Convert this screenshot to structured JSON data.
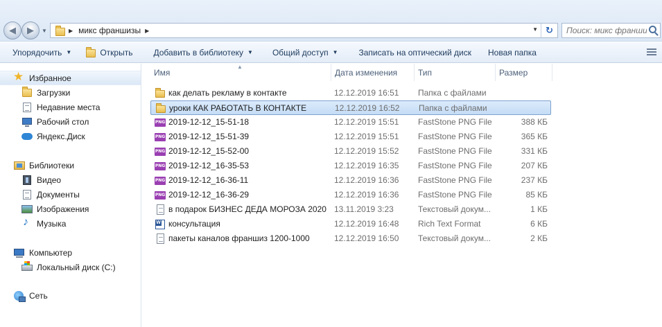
{
  "address": {
    "breadcrumb": "микс франшизы",
    "search_placeholder": "Поиск: микс франшизы"
  },
  "toolbar": {
    "organize": "Упорядочить",
    "open": "Открыть",
    "add_library": "Добавить в библиотеку",
    "share": "Общий доступ",
    "burn": "Записать на оптический диск",
    "new_folder": "Новая папка"
  },
  "nav": {
    "favorites": "Избранное",
    "downloads": "Загрузки",
    "recent": "Недавние места",
    "desktop": "Рабочий стол",
    "yadisk": "Яндекс.Диск",
    "libraries": "Библиотеки",
    "video": "Видео",
    "documents": "Документы",
    "images": "Изображения",
    "music": "Музыка",
    "computer": "Компьютер",
    "local_disk": "Локальный диск (C:)",
    "network": "Сеть"
  },
  "columns": {
    "name": "Имя",
    "date": "Дата изменения",
    "type": "Тип",
    "size": "Размер"
  },
  "files": [
    {
      "name": "как делать рекламу в контакте",
      "date": "12.12.2019 16:51",
      "type": "Папка с файлами",
      "size": "",
      "icon": "folder-icon"
    },
    {
      "name": "уроки КАК РАБОТАТЬ В КОНТАКТЕ",
      "date": "12.12.2019 16:52",
      "type": "Папка с файлами",
      "size": "",
      "icon": "folder-icon"
    },
    {
      "name": "2019-12-12_15-51-18",
      "date": "12.12.2019 15:51",
      "type": "FastStone PNG File",
      "size": "388 КБ",
      "icon": "png-file-icon"
    },
    {
      "name": "2019-12-12_15-51-39",
      "date": "12.12.2019 15:51",
      "type": "FastStone PNG File",
      "size": "365 КБ",
      "icon": "png-file-icon"
    },
    {
      "name": "2019-12-12_15-52-00",
      "date": "12.12.2019 15:52",
      "type": "FastStone PNG File",
      "size": "331 КБ",
      "icon": "png-file-icon"
    },
    {
      "name": "2019-12-12_16-35-53",
      "date": "12.12.2019 16:35",
      "type": "FastStone PNG File",
      "size": "207 КБ",
      "icon": "png-file-icon"
    },
    {
      "name": "2019-12-12_16-36-11",
      "date": "12.12.2019 16:36",
      "type": "FastStone PNG File",
      "size": "237 КБ",
      "icon": "png-file-icon"
    },
    {
      "name": "2019-12-12_16-36-29",
      "date": "12.12.2019 16:36",
      "type": "FastStone PNG File",
      "size": "85 КБ",
      "icon": "png-file-icon"
    },
    {
      "name": "в подарок БИЗНЕС ДЕДА МОРОЗА 2020",
      "date": "13.11.2019 3:23",
      "type": "Текстовый докум...",
      "size": "1 КБ",
      "icon": "text-file-icon"
    },
    {
      "name": "консультация",
      "date": "12.12.2019 16:48",
      "type": "Rich Text Format",
      "size": "6 КБ",
      "icon": "rtf-file-icon"
    },
    {
      "name": "пакеты каналов франшиз 1200-1000",
      "date": "12.12.2019 16:50",
      "type": "Текстовый докум...",
      "size": "2 КБ",
      "icon": "text-file-icon"
    }
  ],
  "selected_file_index": 1,
  "png_badge": "PNG",
  "colors": {
    "selection": "#c4dcf5",
    "selection_border": "#7da2ce",
    "toolbar_text": "#1e3b5e",
    "column_header_text": "#4c607a"
  }
}
